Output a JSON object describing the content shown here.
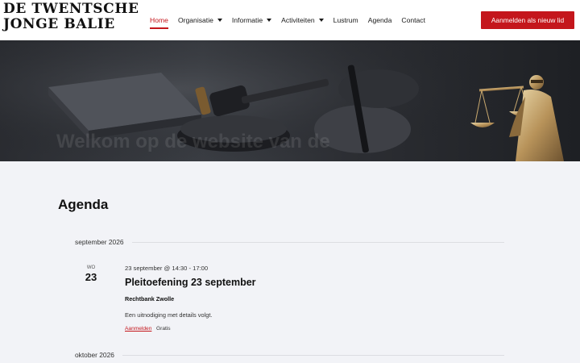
{
  "logo": {
    "line1": "De Twentsche",
    "line2": "Jonge Balie"
  },
  "nav": {
    "items": [
      {
        "label": "Home",
        "active": true,
        "dropdown": false
      },
      {
        "label": "Organisatie",
        "active": false,
        "dropdown": true
      },
      {
        "label": "Informatie",
        "active": false,
        "dropdown": true
      },
      {
        "label": "Activiteiten",
        "active": false,
        "dropdown": true
      },
      {
        "label": "Lustrum",
        "active": false,
        "dropdown": false
      },
      {
        "label": "Agenda",
        "active": false,
        "dropdown": false
      },
      {
        "label": "Contact",
        "active": false,
        "dropdown": false
      }
    ],
    "cta_label": "Aanmelden als nieuw lid"
  },
  "hero": {
    "overlay_text": "Welkom op de website van de"
  },
  "main": {
    "title": "Agenda",
    "months": [
      {
        "label": "september 2026"
      },
      {
        "label": "oktober 2026"
      }
    ],
    "event": {
      "dow": "WO",
      "day": "23",
      "time": "23 september @ 14:30 - 17:00",
      "title": "Pleitoefening 23 september",
      "venue": "Rechtbank Zwolle",
      "description": "Een uitnodiging met details volgt.",
      "register_label": "Aanmelden",
      "cost": "Gratis"
    }
  },
  "colors": {
    "accent": "#c4161c",
    "page_bg": "#f2f3f7",
    "header_bg": "#ffffff"
  }
}
